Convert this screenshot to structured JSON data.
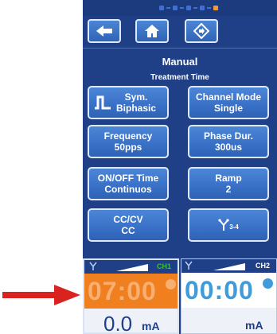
{
  "header": {
    "title": "Manual",
    "subtitle": "Treatment Time"
  },
  "nav": {
    "back_icon": "arrow-left-icon",
    "home_icon": "home-icon",
    "menu_icon": "diamond-arrow-icon"
  },
  "buttons": {
    "sym": {
      "line1": "Sym.",
      "line2": "Biphasic",
      "icon": "biphasic-wave-icon"
    },
    "channel_mode": {
      "line1": "Channel Mode",
      "line2": "Single"
    },
    "frequency": {
      "line1": "Frequency",
      "line2": "50pps"
    },
    "phase_dur": {
      "line1": "Phase Dur.",
      "line2": "300us"
    },
    "onoff": {
      "line1": "ON/OFF Time",
      "line2": "Continuos"
    },
    "ramp": {
      "line1": "Ramp",
      "line2": "2"
    },
    "cccv": {
      "line1": "CC/CV",
      "line2": "CC"
    },
    "channels": {
      "label": "3-4",
      "icon": "channel-split-icon"
    }
  },
  "ch1": {
    "label": "CH1",
    "timer": "07:00",
    "current_value": "0.0",
    "current_unit": "mA"
  },
  "ch2": {
    "label": "CH2",
    "timer": "00:00",
    "current_value": "",
    "current_unit": "mA"
  },
  "colors": {
    "panel": "#1f3f86",
    "button": "#3a72c8",
    "active_orange": "#f07f20",
    "ch1_label": "#3fbf3f",
    "ch2_timer": "#3f9bd9",
    "arrow": "#d8231f"
  }
}
